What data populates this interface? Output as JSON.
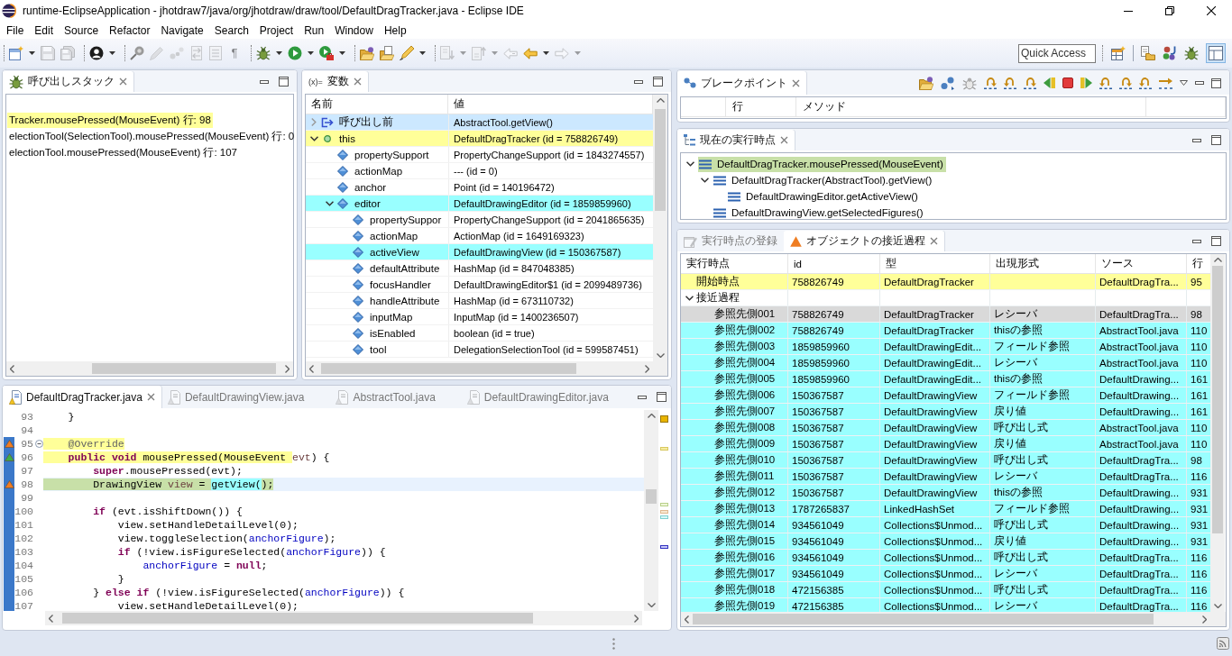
{
  "window": {
    "title": "runtime-EclipseApplication - jhotdraw7/java/org/jhotdraw/draw/tool/DefaultDragTracker.java - Eclipse IDE"
  },
  "menu": [
    "File",
    "Edit",
    "Source",
    "Refactor",
    "Navigate",
    "Search",
    "Project",
    "Run",
    "Window",
    "Help"
  ],
  "toolbar": {
    "groups": [
      [
        {
          "dropdown": true,
          "disabled": false
        },
        {
          "dropdown": false,
          "disabled": true
        },
        {
          "dropdown": false,
          "disabled": true
        }
      ],
      [
        {
          "dropdown": true,
          "disabled": false
        }
      ],
      [
        {
          "dropdown": false,
          "disabled": false
        },
        {
          "dropdown": false,
          "disabled": true
        },
        {
          "dropdown": false,
          "disabled": true
        },
        {
          "dropdown": false,
          "disabled": true
        },
        {
          "dropdown": false,
          "disabled": true
        },
        {
          "dropdown": false,
          "disabled": true,
          "glyph": "¶"
        }
      ],
      [
        {
          "dropdown": true,
          "disabled": false
        },
        {
          "dropdown": true,
          "disabled": false
        },
        {
          "dropdown": true,
          "disabled": false
        }
      ],
      [
        {
          "dropdown": false,
          "disabled": false
        },
        {
          "dropdown": false,
          "disabled": false
        },
        {
          "dropdown": true,
          "disabled": false
        }
      ],
      [
        {
          "dropdown": true,
          "disabled": true
        },
        {
          "dropdown": true,
          "disabled": true
        },
        {
          "dropdown": false,
          "disabled": true
        },
        {
          "dropdown": true,
          "disabled": false
        },
        {
          "dropdown": true,
          "disabled": true
        }
      ]
    ],
    "quick_access": {
      "placeholder": "Quick Access"
    },
    "perspectives": [
      {
        "selected": false
      },
      {
        "selected": false
      },
      {
        "selected": false
      },
      {
        "selected": true
      }
    ]
  },
  "call_stack": {
    "tab": "呼び出しスタック",
    "frames": [
      {
        "text": "Tracker.mousePressed(MouseEvent) 行: 98",
        "selected": false,
        "color": "#ffff99"
      },
      {
        "text": "electionTool(SelectionTool).mousePressed(MouseEvent) 行: 0",
        "selected": false
      },
      {
        "text": "electionTool.mousePressed(MouseEvent) 行: 107",
        "selected": false
      }
    ]
  },
  "variables": {
    "symbol": "(x)=",
    "tab": "変数",
    "columns": [
      "名前",
      "値"
    ],
    "rows": [
      {
        "name": "呼び出し前",
        "value": "AbstractTool.getView()",
        "kind": "return",
        "expanded": false,
        "selected": true
      },
      {
        "name": "this",
        "value": "DefaultDragTracker (id = 758826749)",
        "kind": "local",
        "expanded": true,
        "selected": false,
        "color": "#ffff99",
        "children": [
          {
            "name": "propertySupport",
            "value": "PropertyChangeSupport (id = 1843274557)",
            "kind": "field",
            "selected": false
          },
          {
            "name": "actionMap",
            "value": "--- (id = 0)",
            "kind": "field",
            "selected": false
          },
          {
            "name": "anchor",
            "value": "Point (id = 140196472)",
            "kind": "field",
            "selected": false
          },
          {
            "name": "editor",
            "value": "DefaultDrawingEditor (id = 1859859960)",
            "kind": "field",
            "expanded": true,
            "selected": false,
            "color": "#99ffff",
            "children": [
              {
                "name": "propertySuppor",
                "value": "PropertyChangeSupport (id = 2041865635)",
                "kind": "field",
                "selected": false
              },
              {
                "name": "actionMap",
                "value": "ActionMap (id = 1649169323)",
                "kind": "field",
                "selected": false
              },
              {
                "name": "activeView",
                "value": "DefaultDrawingView (id = 150367587)",
                "kind": "field",
                "selected": false,
                "color": "#99ffff"
              },
              {
                "name": "defaultAttribute",
                "value": "HashMap (id = 847048385)",
                "kind": "field",
                "selected": false
              },
              {
                "name": "focusHandler",
                "value": "DefaultDrawingEditor$1 (id = 2099489736)",
                "kind": "field",
                "selected": false
              },
              {
                "name": "handleAttribute",
                "value": "HashMap (id = 673110732)",
                "kind": "field",
                "selected": false
              },
              {
                "name": "inputMap",
                "value": "InputMap (id = 1400236507)",
                "kind": "field",
                "selected": false
              },
              {
                "name": "isEnabled",
                "value": "boolean (id = true)",
                "kind": "field",
                "selected": false
              },
              {
                "name": "tool",
                "value": "DelegationSelectionTool (id = 599587451)",
                "kind": "field",
                "selected": false
              }
            ]
          }
        ]
      }
    ]
  },
  "editor": {
    "tabs": [
      {
        "label": "DefaultDragTracker.java",
        "selected": true
      },
      {
        "label": "DefaultDrawingView.java",
        "selected": false
      },
      {
        "label": "AbstractTool.java",
        "selected": false
      },
      {
        "label": "DefaultDrawingEditor.java",
        "selected": false
      }
    ],
    "lines": [
      {
        "number": "93",
        "range": false,
        "current": false,
        "tokens": [
          {
            "text": "    }",
            "kind": "plain"
          }
        ]
      },
      {
        "number": "94",
        "range": false,
        "current": false
      },
      {
        "number": "95",
        "range": true,
        "current": false,
        "marker": {
          "color": "#f07c22"
        },
        "folded": false,
        "tokens": [
          {
            "text": "    @Override",
            "kind": "annotation",
            "color": "#ffff99"
          }
        ]
      },
      {
        "number": "96",
        "range": true,
        "current": false,
        "marker": {
          "color": "#3fae49"
        },
        "tokens": [
          {
            "text": "    public",
            "kind": "keyword",
            "color": "#ffff99"
          },
          {
            "text": " void",
            "kind": "keyword",
            "color": "#ffff99"
          },
          {
            "text": " mousePressed(MouseEvent ",
            "kind": "plain",
            "color": "#ffff99"
          },
          {
            "text": "evt",
            "kind": "local"
          },
          {
            "text": ") {",
            "kind": "plain"
          }
        ]
      },
      {
        "number": "97",
        "range": true,
        "current": false,
        "tokens": [
          {
            "text": "        super",
            "kind": "keyword"
          },
          {
            "text": ".mousePressed(evt);",
            "kind": "plain"
          }
        ]
      },
      {
        "number": "98",
        "range": true,
        "current": true,
        "marker": {
          "color": "#f07c22"
        },
        "tokens": [
          {
            "text": "        DrawingView ",
            "kind": "plain",
            "color": "#c8e0a8"
          },
          {
            "text": "view",
            "kind": "local",
            "color": "#c8e0a8"
          },
          {
            "text": " = ",
            "kind": "plain",
            "color": "#c8e0a8"
          },
          {
            "text": "getView(",
            "kind": "plain",
            "color": "#99ffff"
          },
          {
            "text": ");",
            "kind": "plain",
            "color": "#c8e0a8"
          }
        ]
      },
      {
        "number": "99",
        "range": true,
        "current": false
      },
      {
        "number": "100",
        "range": true,
        "current": false,
        "tokens": [
          {
            "text": "        if",
            "kind": "keyword"
          },
          {
            "text": " (evt.isShiftDown()) {",
            "kind": "plain"
          }
        ]
      },
      {
        "number": "101",
        "range": true,
        "current": false,
        "tokens": [
          {
            "text": "            view.setHandleDetailLevel(0);",
            "kind": "plain"
          }
        ]
      },
      {
        "number": "102",
        "range": true,
        "current": false,
        "tokens": [
          {
            "text": "            view.toggleSelection(",
            "kind": "plain"
          },
          {
            "text": "anchorFigure",
            "kind": "field"
          },
          {
            "text": ");",
            "kind": "plain"
          }
        ]
      },
      {
        "number": "103",
        "range": true,
        "current": false,
        "tokens": [
          {
            "text": "            if",
            "kind": "keyword"
          },
          {
            "text": " (!view.isFigureSelected(",
            "kind": "plain"
          },
          {
            "text": "anchorFigure",
            "kind": "field"
          },
          {
            "text": ")) {",
            "kind": "plain"
          }
        ]
      },
      {
        "number": "104",
        "range": true,
        "current": false,
        "tokens": [
          {
            "text": "                anchorFigure",
            "kind": "field"
          },
          {
            "text": " = ",
            "kind": "plain"
          },
          {
            "text": "null",
            "kind": "keyword"
          },
          {
            "text": ";",
            "kind": "plain"
          }
        ]
      },
      {
        "number": "105",
        "range": true,
        "current": false,
        "tokens": [
          {
            "text": "            }",
            "kind": "plain"
          }
        ]
      },
      {
        "number": "106",
        "range": true,
        "current": false,
        "tokens": [
          {
            "text": "        } ",
            "kind": "plain"
          },
          {
            "text": "else",
            "kind": "keyword"
          },
          {
            "text": " if",
            "kind": "keyword"
          },
          {
            "text": " (!view.isFigureSelected(",
            "kind": "plain"
          },
          {
            "text": "anchorFigure",
            "kind": "field"
          },
          {
            "text": ")) {",
            "kind": "plain"
          }
        ]
      },
      {
        "number": "107",
        "range": true,
        "current": false,
        "tokens": [
          {
            "text": "            view.setHandleDetailLevel(0);",
            "kind": "plain"
          }
        ]
      }
    ]
  },
  "breakpoints": {
    "tab": "ブレークポイント",
    "columns": [
      "行",
      "メソッド"
    ]
  },
  "execution_point": {
    "tab": "現在の実行時点",
    "tree": [
      {
        "label": "DefaultDragTracker.mousePressed(MouseEvent)",
        "expanded": true,
        "selected": false,
        "color": "#c8e0a8",
        "children": [
          {
            "label": "DefaultDragTracker(AbstractTool).getView()",
            "expanded": true,
            "selected": false,
            "children": [
              {
                "label": "DefaultDrawingEditor.getActiveView()",
                "selected": false
              }
            ]
          },
          {
            "label": "DefaultDrawingView.getSelectedFigures()",
            "selected": false
          }
        ]
      }
    ]
  },
  "approach": {
    "tabs": [
      {
        "label": "実行時点の登録",
        "selected": false
      },
      {
        "label": "オブジェクトの接近過程",
        "selected": true
      }
    ],
    "columns": [
      "実行時点",
      "id",
      "型",
      "出現形式",
      "ソース",
      "行"
    ],
    "rows": [
      {
        "point": "開始時点",
        "id": "758826749",
        "type": "DefaultDragTracker",
        "source": "DefaultDragTra...",
        "line": "95",
        "selected": false,
        "color": "#ffff99"
      },
      {
        "point": "接近過程",
        "expanded": true,
        "selected": false,
        "children": [
          {
            "point": "参照先側001",
            "id": "758826749",
            "type": "DefaultDragTracker",
            "form": "レシーバ",
            "source": "DefaultDragTra...",
            "line": "98",
            "selected": true
          },
          {
            "point": "参照先側002",
            "id": "758826749",
            "type": "DefaultDragTracker",
            "form": "thisの参照",
            "source": "AbstractTool.java",
            "line": "110",
            "selected": false,
            "color": "#99ffff"
          },
          {
            "point": "参照先側003",
            "id": "1859859960",
            "type": "DefaultDrawingEdit...",
            "form": "フィールド参照",
            "source": "AbstractTool.java",
            "line": "110",
            "selected": false,
            "color": "#99ffff"
          },
          {
            "point": "参照先側004",
            "id": "1859859960",
            "type": "DefaultDrawingEdit...",
            "form": "レシーバ",
            "source": "AbstractTool.java",
            "line": "110",
            "selected": false,
            "color": "#99ffff"
          },
          {
            "point": "参照先側005",
            "id": "1859859960",
            "type": "DefaultDrawingEdit...",
            "form": "thisの参照",
            "source": "DefaultDrawing...",
            "line": "161",
            "selected": false,
            "color": "#99ffff"
          },
          {
            "point": "参照先側006",
            "id": "150367587",
            "type": "DefaultDrawingView",
            "form": "フィールド参照",
            "source": "DefaultDrawing...",
            "line": "161",
            "selected": false,
            "color": "#99ffff"
          },
          {
            "point": "参照先側007",
            "id": "150367587",
            "type": "DefaultDrawingView",
            "form": "戻り値",
            "source": "DefaultDrawing...",
            "line": "161",
            "selected": false,
            "color": "#99ffff"
          },
          {
            "point": "参照先側008",
            "id": "150367587",
            "type": "DefaultDrawingView",
            "form": "呼び出し式",
            "source": "AbstractTool.java",
            "line": "110",
            "selected": false,
            "color": "#99ffff"
          },
          {
            "point": "参照先側009",
            "id": "150367587",
            "type": "DefaultDrawingView",
            "form": "戻り値",
            "source": "AbstractTool.java",
            "line": "110",
            "selected": false,
            "color": "#99ffff"
          },
          {
            "point": "参照先側010",
            "id": "150367587",
            "type": "DefaultDrawingView",
            "form": "呼び出し式",
            "source": "DefaultDragTra...",
            "line": "98",
            "selected": false,
            "color": "#99ffff"
          },
          {
            "point": "参照先側011",
            "id": "150367587",
            "type": "DefaultDrawingView",
            "form": "レシーバ",
            "source": "DefaultDragTra...",
            "line": "116",
            "selected": false,
            "color": "#99ffff"
          },
          {
            "point": "参照先側012",
            "id": "150367587",
            "type": "DefaultDrawingView",
            "form": "thisの参照",
            "source": "DefaultDrawing...",
            "line": "931",
            "selected": false,
            "color": "#99ffff"
          },
          {
            "point": "参照先側013",
            "id": "1787265837",
            "type": "LinkedHashSet",
            "form": "フィールド参照",
            "source": "DefaultDrawing...",
            "line": "931",
            "selected": false,
            "color": "#99ffff"
          },
          {
            "point": "参照先側014",
            "id": "934561049",
            "type": "Collections$Unmod...",
            "form": "呼び出し式",
            "source": "DefaultDrawing...",
            "line": "931",
            "selected": false,
            "color": "#99ffff"
          },
          {
            "point": "参照先側015",
            "id": "934561049",
            "type": "Collections$Unmod...",
            "form": "戻り値",
            "source": "DefaultDrawing...",
            "line": "931",
            "selected": false,
            "color": "#99ffff"
          },
          {
            "point": "参照先側016",
            "id": "934561049",
            "type": "Collections$Unmod...",
            "form": "呼び出し式",
            "source": "DefaultDragTra...",
            "line": "116",
            "selected": false,
            "color": "#99ffff"
          },
          {
            "point": "参照先側017",
            "id": "934561049",
            "type": "Collections$Unmod...",
            "form": "レシーバ",
            "source": "DefaultDragTra...",
            "line": "116",
            "selected": false,
            "color": "#99ffff"
          },
          {
            "point": "参照先側018",
            "id": "472156385",
            "type": "Collections$Unmod...",
            "form": "呼び出し式",
            "source": "DefaultDragTra...",
            "line": "116",
            "selected": false,
            "color": "#99ffff"
          },
          {
            "point": "参照先側019",
            "id": "472156385",
            "type": "Collections$Unmod...",
            "form": "レシーバ",
            "source": "DefaultDragTra...",
            "line": "116",
            "selected": false,
            "color": "#99ffff"
          }
        ]
      }
    ]
  }
}
